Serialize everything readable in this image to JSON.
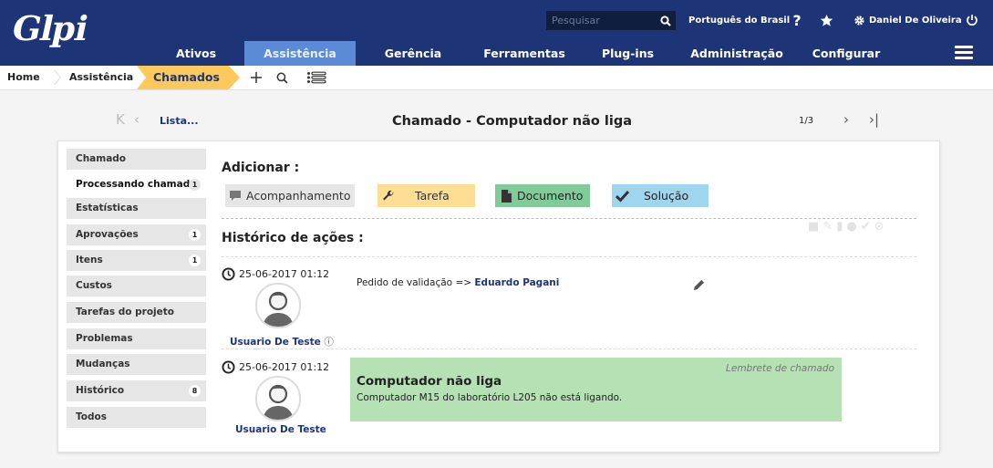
{
  "header": {
    "logo": "Glpi",
    "search": {
      "placeholder": "Pesquisar"
    },
    "language": "Português do Brasil",
    "help_icon": "question-icon",
    "favorite_icon": "star-icon",
    "user": "Daniel De Oliveira",
    "logout_icon": "power-icon",
    "menu": [
      "Ativos",
      "Assistência",
      "Gerência",
      "Ferramentas",
      "Plug-ins",
      "Administração",
      "Configurar"
    ],
    "active_menu": "Assistência"
  },
  "breadcrumb": {
    "items": [
      "Home",
      "Assistência",
      "Chamados"
    ],
    "tools": [
      "plus-icon",
      "search-icon",
      "list-icon"
    ]
  },
  "nav": {
    "list_link": "Lista...",
    "title": "Chamado - Computador não liga",
    "counter": "1/3"
  },
  "sidebar": {
    "items": [
      {
        "label": "Chamado",
        "count": ""
      },
      {
        "label": "Processando chamado",
        "count": "1"
      },
      {
        "label": "Estatísticas",
        "count": ""
      },
      {
        "label": "Aprovações",
        "count": "1"
      },
      {
        "label": "Itens",
        "count": "1"
      },
      {
        "label": "Custos",
        "count": ""
      },
      {
        "label": "Tarefas do projeto",
        "count": ""
      },
      {
        "label": "Problemas",
        "count": ""
      },
      {
        "label": "Mudanças",
        "count": ""
      },
      {
        "label": "Histórico",
        "count": "8"
      },
      {
        "label": "Todos",
        "count": ""
      }
    ],
    "active": "Processando chamado"
  },
  "main": {
    "add_heading": "Adicionar :",
    "actions": [
      {
        "label": "Acompanhamento",
        "color": "#e6e6e6",
        "icon": "comment-icon"
      },
      {
        "label": "Tarefa",
        "color": "#fede94",
        "icon": "wrench-icon"
      },
      {
        "label": "Documento",
        "color": "#7fcc99",
        "icon": "file-icon"
      },
      {
        "label": "Solução",
        "color": "#9fd6ed",
        "icon": "check-icon"
      }
    ],
    "history_heading": "Histórico de ações :",
    "timeline": [
      {
        "date": "25-06-2017 01:12",
        "user": "Usuario De Teste",
        "text_prefix": "Pedido de validação => ",
        "text_link": "Eduardo Pagani",
        "edit_icon": "pencil-icon"
      },
      {
        "date": "25-06-2017 01:12",
        "user": "Usuario De Teste",
        "reminder": "Lembrete de chamado",
        "title": "Computador não liga",
        "content": "Computador M15 do laboratório L205 não está ligando.",
        "color": "#b5e1b4"
      }
    ]
  }
}
